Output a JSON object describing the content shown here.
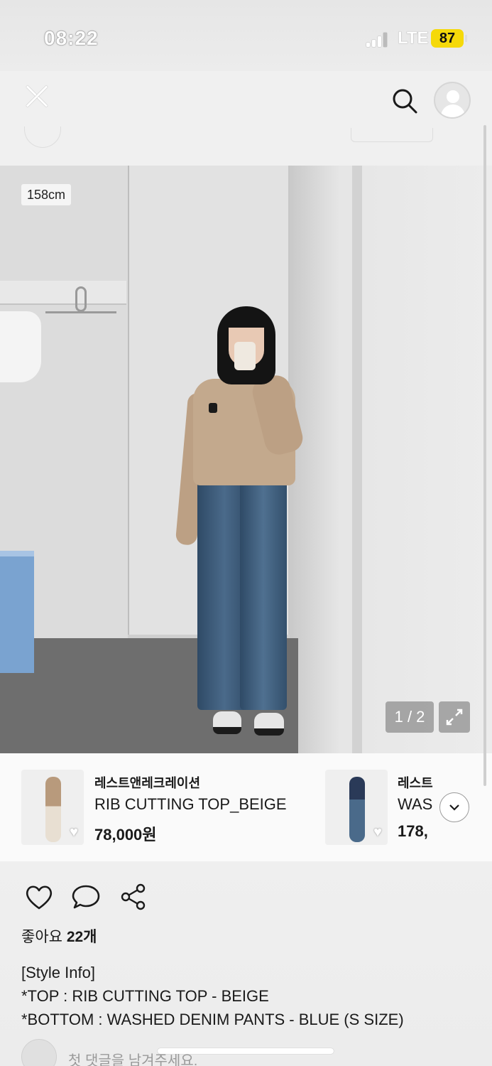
{
  "status_bar": {
    "time": "08:22",
    "network": "LTE",
    "battery": "87"
  },
  "photo": {
    "height_label": "158cm",
    "page_counter": "1 / 2"
  },
  "products": [
    {
      "brand": "레스트앤레크레이션",
      "name": "RIB CUTTING TOP_BEIGE",
      "price": "78,000원",
      "liked": false
    },
    {
      "brand": "레스트",
      "name": "WAS",
      "price": "178,",
      "liked": false
    }
  ],
  "post": {
    "likes_label": "좋아요",
    "likes_count": "22개",
    "caption": "[Style Info]\n*TOP : RIB CUTTING TOP - BEIGE\n*BOTTOM : WASHED DENIM PANTS - BLUE (S SIZE)",
    "comment_placeholder": "첫 댓글을 남겨주세요."
  },
  "colors": {
    "accent": "#f5d90a",
    "text": "#1a1a1a",
    "muted": "#9a9a9a"
  }
}
